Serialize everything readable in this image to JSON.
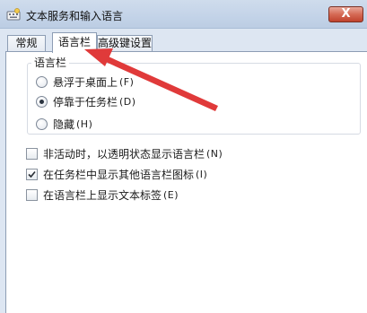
{
  "window": {
    "title": "文本服务和输入语言",
    "close_label": "X"
  },
  "tabs": [
    {
      "label": "常规",
      "active": false
    },
    {
      "label": "语言栏",
      "active": true
    },
    {
      "label": "高级键设置",
      "active": false
    }
  ],
  "language_bar_group": {
    "title": "语言栏",
    "options": [
      {
        "label": "悬浮于桌面上",
        "hotkey": "(F)",
        "checked": false
      },
      {
        "label": "停靠于任务栏",
        "hotkey": "(D)",
        "checked": true
      },
      {
        "label": "隐藏",
        "hotkey": "(H)",
        "checked": false
      }
    ]
  },
  "checkboxes": [
    {
      "label": "非活动时，以透明状态显示语言栏",
      "hotkey": "(N)",
      "checked": false
    },
    {
      "label": "在任务栏中显示其他语言栏图标",
      "hotkey": "(I)",
      "checked": true
    },
    {
      "label": "在语言栏上显示文本标签",
      "hotkey": "(E)",
      "checked": false
    }
  ],
  "annotation": {
    "arrow_color": "#e03a3a"
  },
  "colors": {
    "titlebar": "#c3d3e8",
    "close_button": "#d56a55",
    "panel": "#ffffff"
  }
}
